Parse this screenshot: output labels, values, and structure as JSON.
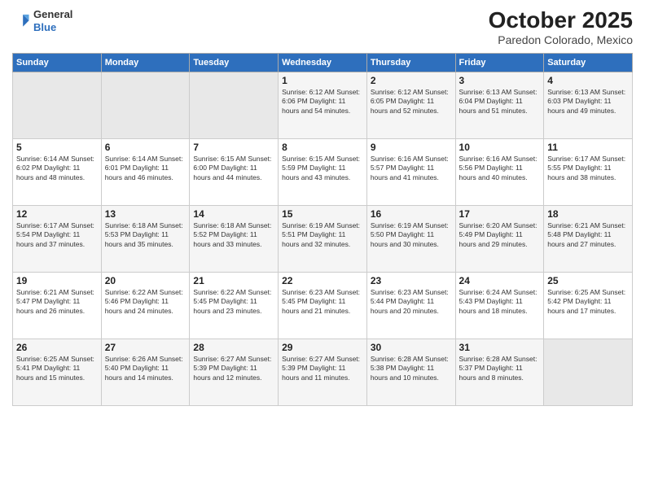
{
  "header": {
    "logo_general": "General",
    "logo_blue": "Blue",
    "month": "October 2025",
    "location": "Paredon Colorado, Mexico"
  },
  "weekdays": [
    "Sunday",
    "Monday",
    "Tuesday",
    "Wednesday",
    "Thursday",
    "Friday",
    "Saturday"
  ],
  "weeks": [
    [
      {
        "day": "",
        "info": ""
      },
      {
        "day": "",
        "info": ""
      },
      {
        "day": "",
        "info": ""
      },
      {
        "day": "1",
        "info": "Sunrise: 6:12 AM\nSunset: 6:06 PM\nDaylight: 11 hours\nand 54 minutes."
      },
      {
        "day": "2",
        "info": "Sunrise: 6:12 AM\nSunset: 6:05 PM\nDaylight: 11 hours\nand 52 minutes."
      },
      {
        "day": "3",
        "info": "Sunrise: 6:13 AM\nSunset: 6:04 PM\nDaylight: 11 hours\nand 51 minutes."
      },
      {
        "day": "4",
        "info": "Sunrise: 6:13 AM\nSunset: 6:03 PM\nDaylight: 11 hours\nand 49 minutes."
      }
    ],
    [
      {
        "day": "5",
        "info": "Sunrise: 6:14 AM\nSunset: 6:02 PM\nDaylight: 11 hours\nand 48 minutes."
      },
      {
        "day": "6",
        "info": "Sunrise: 6:14 AM\nSunset: 6:01 PM\nDaylight: 11 hours\nand 46 minutes."
      },
      {
        "day": "7",
        "info": "Sunrise: 6:15 AM\nSunset: 6:00 PM\nDaylight: 11 hours\nand 44 minutes."
      },
      {
        "day": "8",
        "info": "Sunrise: 6:15 AM\nSunset: 5:59 PM\nDaylight: 11 hours\nand 43 minutes."
      },
      {
        "day": "9",
        "info": "Sunrise: 6:16 AM\nSunset: 5:57 PM\nDaylight: 11 hours\nand 41 minutes."
      },
      {
        "day": "10",
        "info": "Sunrise: 6:16 AM\nSunset: 5:56 PM\nDaylight: 11 hours\nand 40 minutes."
      },
      {
        "day": "11",
        "info": "Sunrise: 6:17 AM\nSunset: 5:55 PM\nDaylight: 11 hours\nand 38 minutes."
      }
    ],
    [
      {
        "day": "12",
        "info": "Sunrise: 6:17 AM\nSunset: 5:54 PM\nDaylight: 11 hours\nand 37 minutes."
      },
      {
        "day": "13",
        "info": "Sunrise: 6:18 AM\nSunset: 5:53 PM\nDaylight: 11 hours\nand 35 minutes."
      },
      {
        "day": "14",
        "info": "Sunrise: 6:18 AM\nSunset: 5:52 PM\nDaylight: 11 hours\nand 33 minutes."
      },
      {
        "day": "15",
        "info": "Sunrise: 6:19 AM\nSunset: 5:51 PM\nDaylight: 11 hours\nand 32 minutes."
      },
      {
        "day": "16",
        "info": "Sunrise: 6:19 AM\nSunset: 5:50 PM\nDaylight: 11 hours\nand 30 minutes."
      },
      {
        "day": "17",
        "info": "Sunrise: 6:20 AM\nSunset: 5:49 PM\nDaylight: 11 hours\nand 29 minutes."
      },
      {
        "day": "18",
        "info": "Sunrise: 6:21 AM\nSunset: 5:48 PM\nDaylight: 11 hours\nand 27 minutes."
      }
    ],
    [
      {
        "day": "19",
        "info": "Sunrise: 6:21 AM\nSunset: 5:47 PM\nDaylight: 11 hours\nand 26 minutes."
      },
      {
        "day": "20",
        "info": "Sunrise: 6:22 AM\nSunset: 5:46 PM\nDaylight: 11 hours\nand 24 minutes."
      },
      {
        "day": "21",
        "info": "Sunrise: 6:22 AM\nSunset: 5:45 PM\nDaylight: 11 hours\nand 23 minutes."
      },
      {
        "day": "22",
        "info": "Sunrise: 6:23 AM\nSunset: 5:45 PM\nDaylight: 11 hours\nand 21 minutes."
      },
      {
        "day": "23",
        "info": "Sunrise: 6:23 AM\nSunset: 5:44 PM\nDaylight: 11 hours\nand 20 minutes."
      },
      {
        "day": "24",
        "info": "Sunrise: 6:24 AM\nSunset: 5:43 PM\nDaylight: 11 hours\nand 18 minutes."
      },
      {
        "day": "25",
        "info": "Sunrise: 6:25 AM\nSunset: 5:42 PM\nDaylight: 11 hours\nand 17 minutes."
      }
    ],
    [
      {
        "day": "26",
        "info": "Sunrise: 6:25 AM\nSunset: 5:41 PM\nDaylight: 11 hours\nand 15 minutes."
      },
      {
        "day": "27",
        "info": "Sunrise: 6:26 AM\nSunset: 5:40 PM\nDaylight: 11 hours\nand 14 minutes."
      },
      {
        "day": "28",
        "info": "Sunrise: 6:27 AM\nSunset: 5:39 PM\nDaylight: 11 hours\nand 12 minutes."
      },
      {
        "day": "29",
        "info": "Sunrise: 6:27 AM\nSunset: 5:39 PM\nDaylight: 11 hours\nand 11 minutes."
      },
      {
        "day": "30",
        "info": "Sunrise: 6:28 AM\nSunset: 5:38 PM\nDaylight: 11 hours\nand 10 minutes."
      },
      {
        "day": "31",
        "info": "Sunrise: 6:28 AM\nSunset: 5:37 PM\nDaylight: 11 hours\nand 8 minutes."
      },
      {
        "day": "",
        "info": ""
      }
    ]
  ]
}
